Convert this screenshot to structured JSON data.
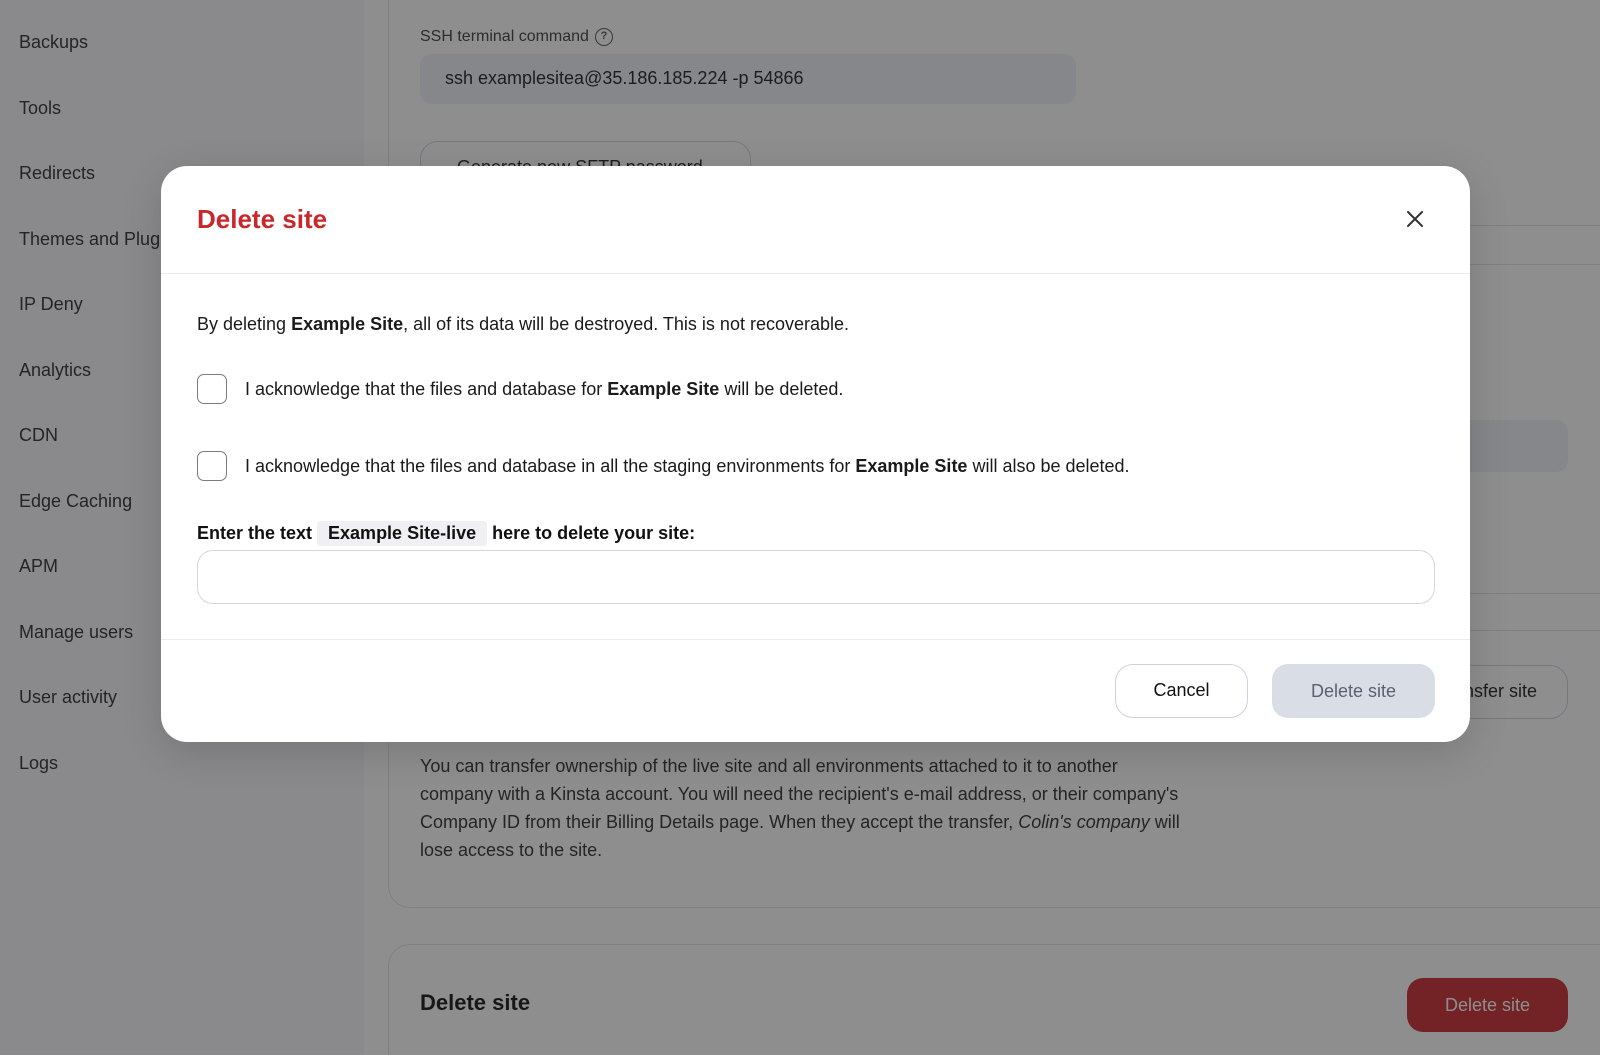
{
  "sidebar": {
    "items": [
      {
        "label": "Backups"
      },
      {
        "label": "Tools"
      },
      {
        "label": "Redirects"
      },
      {
        "label": "Themes and Plugins"
      },
      {
        "label": "IP Deny"
      },
      {
        "label": "Analytics"
      },
      {
        "label": "CDN"
      },
      {
        "label": "Edge Caching"
      },
      {
        "label": "APM"
      },
      {
        "label": "Manage users"
      },
      {
        "label": "User activity"
      },
      {
        "label": "Logs"
      }
    ]
  },
  "page": {
    "ssh": {
      "label": "SSH terminal command",
      "help_icon": "question-circle-icon",
      "value": "ssh examplesitea@35.186.185.224 -p 54866"
    },
    "sftp_button_label": "Generate new SFTP password",
    "transfer": {
      "button_label": "Transfer site",
      "description_before": "You can transfer ownership of the live site and all environments attached to it to another company with a Kinsta account. You will need the recipient's e-mail address, or their company's Company ID from their Billing Details page. When they accept the transfer, ",
      "company_name": "Colin's company",
      "description_after": " will lose access to the site."
    },
    "delete_card": {
      "title": "Delete site",
      "button_label": "Delete site"
    }
  },
  "modal": {
    "title": "Delete site",
    "close_icon": "close-icon",
    "site_name": "Example Site",
    "intro_before": "By deleting ",
    "intro_after": ", all of its data will be destroyed. This is not recoverable.",
    "ack1_before": "I acknowledge that the files and database for ",
    "ack1_after": " will be deleted.",
    "ack2_before": "I acknowledge that the files and database in all the staging environments for ",
    "ack2_after": " will also be deleted.",
    "confirm_before": "Enter the text",
    "confirm_code": "Example Site-live",
    "confirm_after": "here to delete your site:",
    "confirm_value": "",
    "cancel_label": "Cancel",
    "delete_label": "Delete site"
  },
  "colors": {
    "danger": "#c8282b",
    "disabled_button": "#d9dde6",
    "overlay": "rgba(30,30,32,0.5)"
  }
}
